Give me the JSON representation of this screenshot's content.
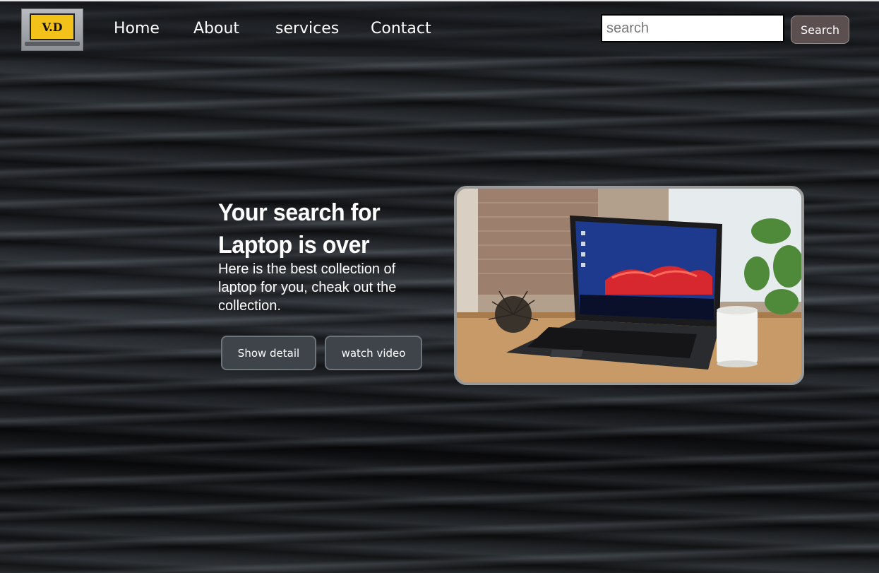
{
  "logo": {
    "text": "V.D"
  },
  "nav": {
    "links": [
      "Home",
      "About",
      "services",
      "Contact"
    ]
  },
  "search": {
    "placeholder": "search",
    "button_label": "Search"
  },
  "hero": {
    "title": "Your search for Laptop is over",
    "subtitle": "Here is the best collection of laptop for you, cheak out the collection.",
    "buttons": [
      "Show detail",
      "watch video"
    ],
    "image_icon": "laptop-photo"
  },
  "colors": {
    "logo_screen": "#f2c21a",
    "search_button_bg": "#5b4f4f",
    "hero_button_bg": "#3e444a"
  }
}
